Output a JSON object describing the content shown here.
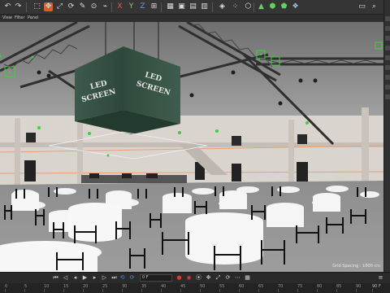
{
  "toolbar": {
    "icons": [
      "undo-icon",
      "redo-icon",
      "select-icon",
      "move-icon",
      "scale-icon",
      "rotate-icon",
      "x-axis-icon",
      "y-axis-icon",
      "z-axis-icon",
      "coordinate-system-icon",
      "render-region-icon",
      "render-view-icon",
      "render-settings-icon",
      "cube-icon",
      "pen-icon",
      "subdivision-icon",
      "generator-icon",
      "deformer-icon",
      "floor-icon",
      "camera-icon",
      "light-icon",
      "tag-icon",
      "snap-icon",
      "grid-icon"
    ],
    "axis_x": "X",
    "axis_y": "Y",
    "axis_z": "Z"
  },
  "viewport_menu": {
    "items": [
      "View",
      "Filter",
      "Panel"
    ]
  },
  "scene": {
    "led_text_line1": "LED",
    "led_text_line2": "SCREEN"
  },
  "status": {
    "grid_spacing": "Grid Spacing : 1000 cm"
  },
  "timeline": {
    "current_frame": "0 F",
    "end_frame": "90 F",
    "ruler": [
      "0",
      "5",
      "10",
      "15",
      "20",
      "25",
      "30",
      "35",
      "40",
      "45",
      "50",
      "55",
      "60",
      "65",
      "70",
      "75",
      "80",
      "85",
      "90"
    ]
  },
  "colors": {
    "null_marker": "#3bd23b",
    "truss": "#333333",
    "record_button": "#d83a3a",
    "active_tool": "#3d6fc4"
  }
}
